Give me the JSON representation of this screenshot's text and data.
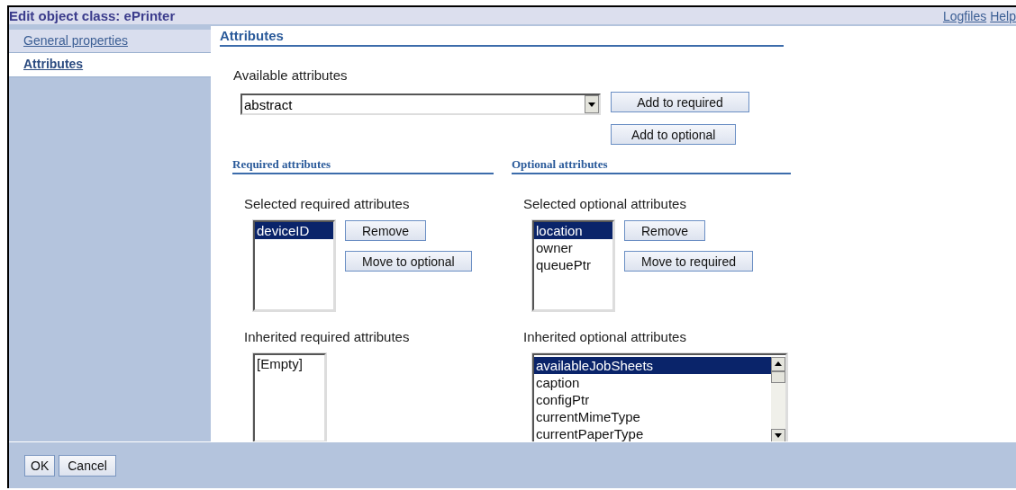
{
  "window": {
    "title": "Edit object class: ePrinter"
  },
  "header_links": [
    "Logfiles",
    "Help"
  ],
  "sidebar": {
    "items": [
      {
        "label": "General properties",
        "selected": false
      },
      {
        "label": "Attributes",
        "selected": true
      }
    ]
  },
  "section_title": "Attributes",
  "available": {
    "label": "Available attributes",
    "value": "abstract",
    "buttons": [
      "Add to required",
      "Add to optional"
    ]
  },
  "groups": [
    {
      "heading": "Required attributes",
      "selected_label": "Selected required attributes",
      "selected_items": [
        {
          "label": "deviceID",
          "selected": true
        }
      ],
      "buttons": [
        "Remove",
        "Move to optional"
      ],
      "inherited_label": "Inherited required attributes",
      "inherited_items": [
        {
          "label": "[Empty]",
          "selected": false
        }
      ],
      "inherited_scroll": false
    },
    {
      "heading": "Optional attributes",
      "selected_label": "Selected optional attributes",
      "selected_items": [
        {
          "label": "location",
          "selected": true
        },
        {
          "label": "owner",
          "selected": false
        },
        {
          "label": "queuePtr",
          "selected": false
        }
      ],
      "buttons": [
        "Remove",
        "Move to required"
      ],
      "inherited_label": "Inherited optional attributes",
      "inherited_items": [
        {
          "label": "availableJobSheets",
          "selected": true
        },
        {
          "label": "caption",
          "selected": false
        },
        {
          "label": "configPtr",
          "selected": false
        },
        {
          "label": "currentMimeType",
          "selected": false
        },
        {
          "label": "currentPaperType",
          "selected": false
        }
      ],
      "inherited_scroll": true
    }
  ],
  "footer_buttons": [
    "OK",
    "Cancel"
  ]
}
